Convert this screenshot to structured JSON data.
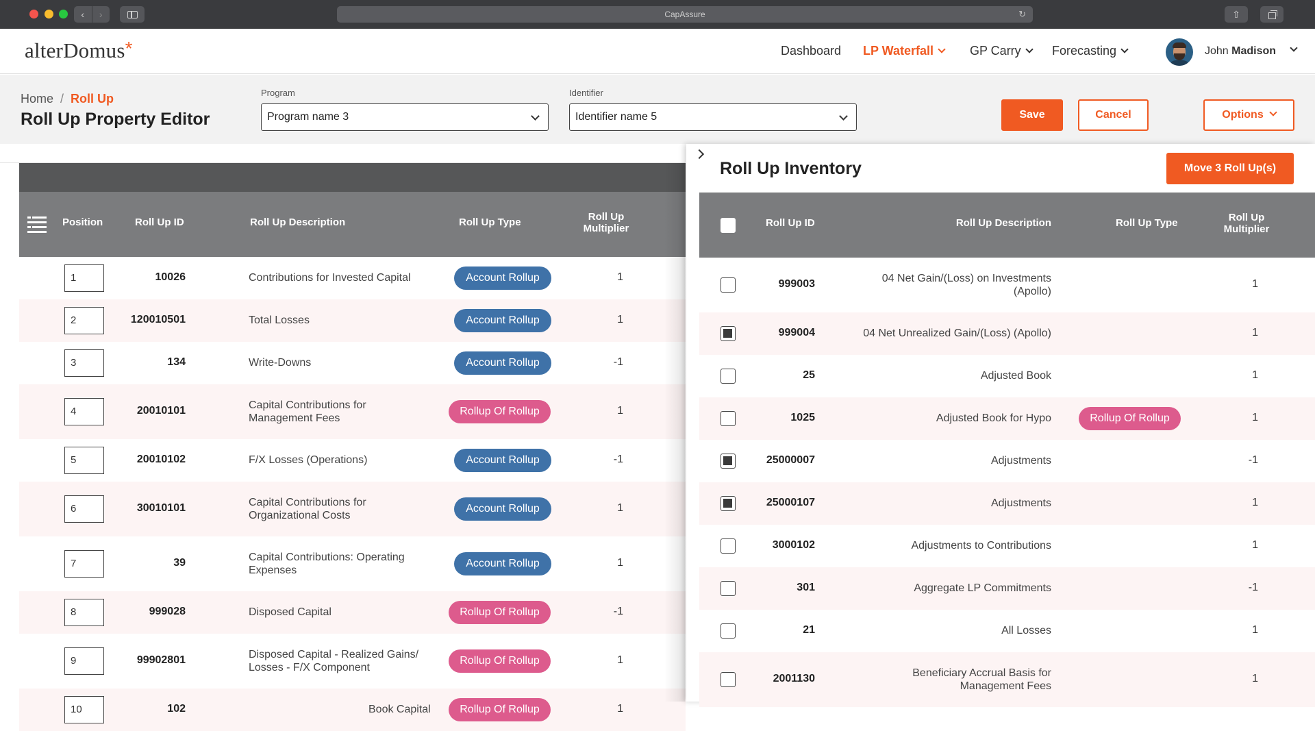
{
  "browser": {
    "url_title": "CapAssure"
  },
  "header": {
    "logo_text": "alterDomus",
    "logo_mark": "*",
    "nav": [
      {
        "label": "Dashboard"
      },
      {
        "label": "LP Waterfall"
      },
      {
        "label": "GP Carry"
      },
      {
        "label": "Forecasting"
      }
    ],
    "user_first": "John",
    "user_last": "Madison"
  },
  "subheader": {
    "crumb_home": "Home",
    "crumb_sep": "/",
    "crumb_current": "Roll Up",
    "title": "Roll Up Property Editor",
    "program_label": "Program",
    "program_value": "Program name 3",
    "identifier_label": "Identifier",
    "identifier_value": "Identifier name 5",
    "save": "Save",
    "cancel": "Cancel",
    "options": "Options"
  },
  "left_table": {
    "headers": {
      "position": "Position",
      "id": "Roll Up ID",
      "description": "Roll Up Description",
      "type": "Roll Up Type",
      "multiplier_1": "Roll Up",
      "multiplier_2": "Multiplier"
    },
    "rows": [
      {
        "position": "1",
        "id": "10026",
        "description": "Contributions for Invested Capital",
        "type": "Account Rollup",
        "multiplier": "1"
      },
      {
        "position": "2",
        "id": "120010501",
        "description": "Total Losses",
        "type": "Account Rollup",
        "multiplier": "1"
      },
      {
        "position": "3",
        "id": "134",
        "description": "Write-Downs",
        "type": "Account Rollup",
        "multiplier": "-1"
      },
      {
        "position": "4",
        "id": "20010101",
        "description": "Capital Contributions for Management Fees",
        "type": "Rollup Of Rollup",
        "multiplier": "1"
      },
      {
        "position": "5",
        "id": "20010102",
        "description": "F/X Losses (Operations)",
        "type": "Account Rollup",
        "multiplier": "-1"
      },
      {
        "position": "6",
        "id": "30010101",
        "description": "Capital Contributions for Organizational Costs",
        "type": "Account Rollup",
        "multiplier": "1"
      },
      {
        "position": "7",
        "id": "39",
        "description": "Capital Contributions: Operating Expenses",
        "type": "Account Rollup",
        "multiplier": "1"
      },
      {
        "position": "8",
        "id": "999028",
        "description": "Disposed Capital",
        "type": "Rollup Of Rollup",
        "multiplier": "-1"
      },
      {
        "position": "9",
        "id": "99902801",
        "description": "Disposed Capital - Realized Gains/ Losses - F/X Component",
        "type": "Rollup Of Rollup",
        "multiplier": "1"
      },
      {
        "position": "10",
        "id": "102",
        "description": "Book Capital",
        "type": "Rollup Of Rollup",
        "multiplier": "1"
      }
    ]
  },
  "inventory": {
    "title": "Roll Up Inventory",
    "move_button": "Move 3 Roll Up(s)",
    "headers": {
      "id": "Roll Up ID",
      "description": "Roll Up Description",
      "type": "Roll Up Type",
      "multiplier_1": "Roll Up",
      "multiplier_2": "Multiplier"
    },
    "rows": [
      {
        "checked": false,
        "id": "999003",
        "description": "04 Net Gain/(Loss) on Investments (Apollo)",
        "type": "",
        "multiplier": "1"
      },
      {
        "checked": true,
        "id": "999004",
        "description": "04 Net Unrealized Gain/(Loss) (Apollo)",
        "type": "",
        "multiplier": "1"
      },
      {
        "checked": false,
        "id": "25",
        "description": "Adjusted Book",
        "type": "",
        "multiplier": "1"
      },
      {
        "checked": false,
        "id": "1025",
        "description": "Adjusted Book for Hypo",
        "type": "Rollup Of Rollup",
        "multiplier": "1"
      },
      {
        "checked": true,
        "id": "25000007",
        "description": "Adjustments",
        "type": "",
        "multiplier": "-1"
      },
      {
        "checked": true,
        "id": "25000107",
        "description": "Adjustments",
        "type": "",
        "multiplier": "1"
      },
      {
        "checked": false,
        "id": "3000102",
        "description": "Adjustments to Contributions",
        "type": "",
        "multiplier": "1"
      },
      {
        "checked": false,
        "id": "301",
        "description": "Aggregate LP Commitments",
        "type": "",
        "multiplier": "-1"
      },
      {
        "checked": false,
        "id": "21",
        "description": "All Losses",
        "type": "",
        "multiplier": "1"
      },
      {
        "checked": false,
        "id": "2001130",
        "description": "Beneficiary Accrual Basis for Management Fees",
        "type": "",
        "multiplier": "1"
      }
    ]
  }
}
